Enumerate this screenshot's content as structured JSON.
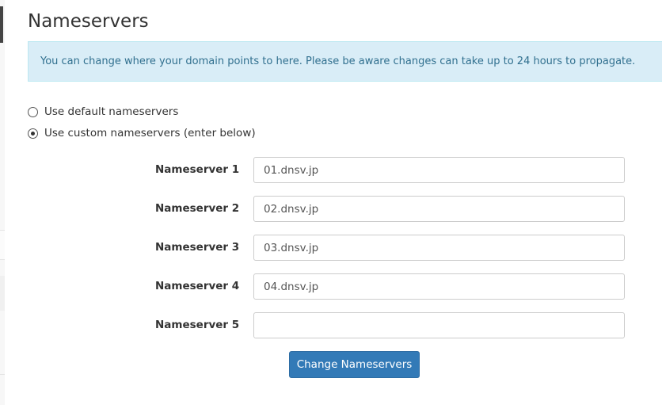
{
  "page": {
    "title": "Nameservers",
    "info_message": "You can change where your domain points to here. Please be aware changes can take up to 24 hours to propagate."
  },
  "options": {
    "default_label": "Use default nameservers",
    "custom_label": "Use custom nameservers (enter below)",
    "selected": "custom"
  },
  "nameservers": [
    {
      "label": "Nameserver 1",
      "value": "01.dnsv.jp"
    },
    {
      "label": "Nameserver 2",
      "value": "02.dnsv.jp"
    },
    {
      "label": "Nameserver 3",
      "value": "03.dnsv.jp"
    },
    {
      "label": "Nameserver 4",
      "value": "04.dnsv.jp"
    },
    {
      "label": "Nameserver 5",
      "value": ""
    }
  ],
  "actions": {
    "submit_label": "Change Nameservers"
  },
  "colors": {
    "primary": "#337ab7",
    "info_bg": "#d9edf7",
    "info_text": "#31708f"
  }
}
